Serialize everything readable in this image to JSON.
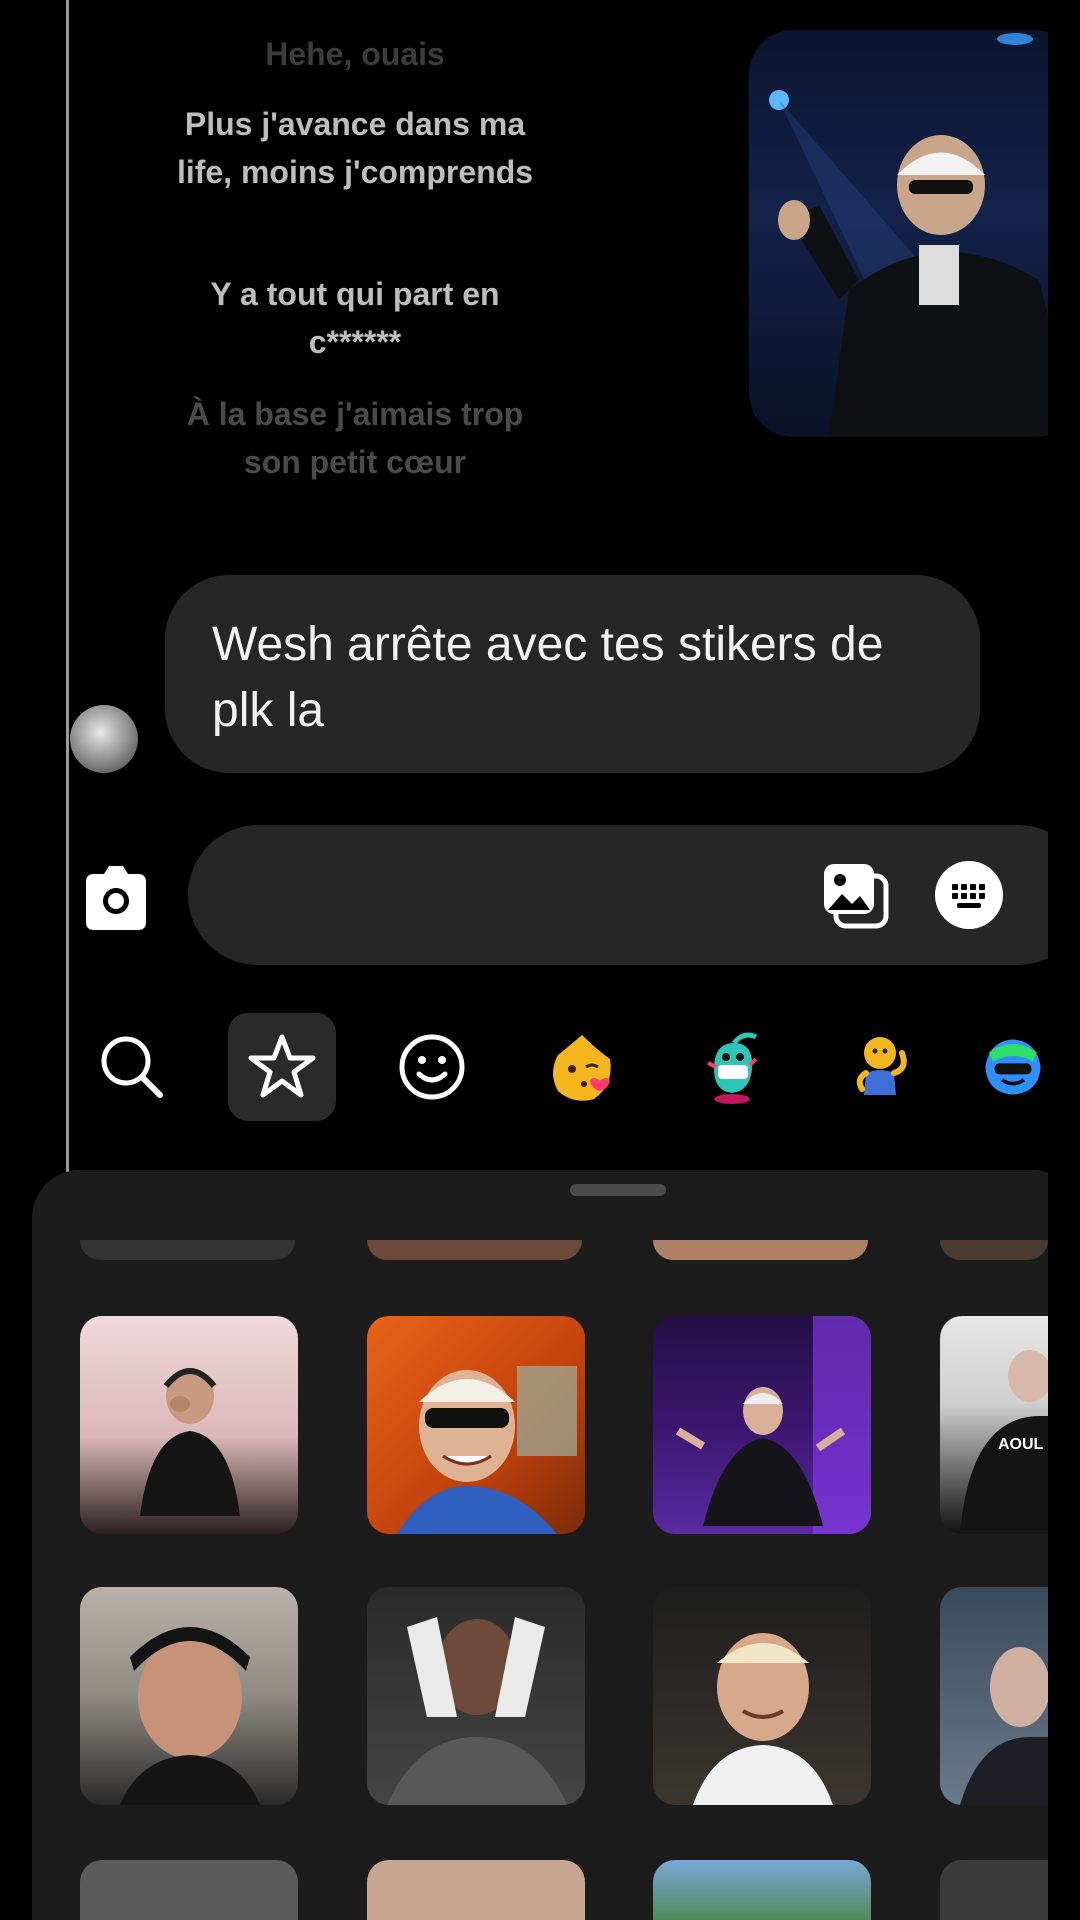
{
  "lyrics": [
    {
      "text": "Hehe, ouais",
      "color": "#3c3c3c"
    },
    {
      "text": "Plus j'avance dans ma life, moins j'comprends",
      "color": "#bdbdbd"
    },
    {
      "text": "Y a tout qui part en c******",
      "color": "#bdbdbd"
    },
    {
      "text": "À la base j'aimais trop son petit cœur",
      "color": "#4a4a4a"
    }
  ],
  "message": {
    "text": "Wesh arrête avec tes stikers de plk la"
  },
  "composer": {
    "placeholder": ""
  },
  "sticker_tabs": [
    {
      "icon": "search-icon"
    },
    {
      "icon": "star-icon",
      "active": true
    },
    {
      "icon": "smiley-icon"
    },
    {
      "icon": "kissing-face-sticker"
    },
    {
      "icon": "alien-creature-sticker"
    },
    {
      "icon": "shrug-character-sticker"
    },
    {
      "icon": "blue-blob-sticker"
    }
  ],
  "stickers": [
    {
      "caption": ""
    },
    {
      "caption": ""
    },
    {
      "caption": ""
    },
    {
      "caption": "AOUL"
    },
    {
      "caption": ""
    },
    {
      "caption": ""
    },
    {
      "caption": ""
    },
    {
      "caption": ""
    }
  ],
  "colors": {
    "background": "#000000",
    "bubble": "#262626",
    "panel": "#1c1c1c",
    "tab_active": "#2a2a2a"
  }
}
